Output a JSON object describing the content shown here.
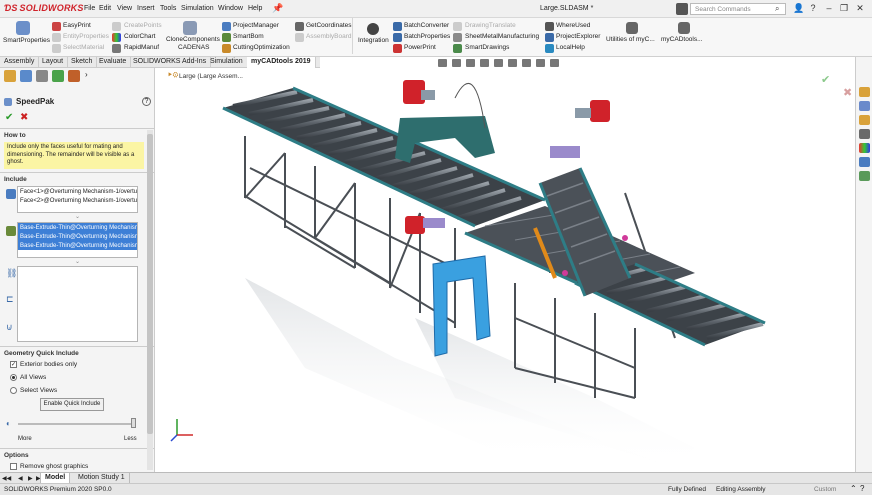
{
  "app": {
    "brand": "SOLIDWORKS",
    "doc_title": "Large.SLDASM *",
    "search_placeholder": "Search Commands"
  },
  "menu": [
    "File",
    "Edit",
    "View",
    "Insert",
    "Tools",
    "Simulation",
    "Window",
    "Help"
  ],
  "ribbon": {
    "smart_properties": "SmartProperties",
    "easyprint": "EasyPrint",
    "entity_properties": "EntityProperties",
    "select_material": "SelectMaterial",
    "create_points": "CreatePoints",
    "color_chart": "ColorChart",
    "rapid_manuf": "RapidManuf",
    "clone_components": "CloneComponents",
    "cadenas": "CADENAS",
    "project_manager": "ProjectManager",
    "smart_bom": "SmartBom",
    "cutting_optimization": "CuttingOptimization",
    "get_coordinates": "GetCoordinates",
    "assembly_board": "AssemblyBoard",
    "integration": "Integration",
    "batch_converter": "BatchConverter",
    "batch_properties": "BatchProperties",
    "power_print": "PowerPrint",
    "drawing_translate": "DrawingTranslate",
    "sheet_metal": "SheetMetalManufacturing",
    "smart_drawings": "SmartDrawings",
    "where_used": "WhereUsed",
    "project_explorer": "ProjectExplorer",
    "local_help": "LocalHelp",
    "utilities": "Utilities of myC...",
    "mycadtools": "myCADtools..."
  },
  "tabs": [
    "Assembly",
    "Layout",
    "Sketch",
    "Evaluate",
    "SOLIDWORKS Add-Ins",
    "Simulation",
    "myCADtools 2019"
  ],
  "active_tab": "myCADtools 2019",
  "panel": {
    "title": "SpeedPak",
    "how_to_title": "How to",
    "how_to_text": "Include only the faces useful for mating and dimensioning.  The remainder will be visible as a ghost.",
    "include_title": "Include",
    "faces": [
      "Face<1>@Overturning Mechanism-1/overtu",
      "Face<2>@Overturning Mechanism-1/overtu"
    ],
    "bodies": [
      "Base-Extrude-Thin@Overturning Mechanism",
      "Base-Extrude-Thin@Overturning Mechanism",
      "Base-Extrude-Thin@Overturning Mechanism"
    ],
    "gqi_title": "Geometry Quick Include",
    "exterior_bodies": "Exterior bodies only",
    "all_views": "All Views",
    "select_views": "Select Views",
    "enable_btn": "Enable Quick Include",
    "more": "More",
    "less": "Less",
    "options_title": "Options",
    "remove_ghost": "Remove ghost graphics"
  },
  "tree_label": "Large  (Large Assem...",
  "bottom_tabs": [
    "Model",
    "Motion Study 1"
  ],
  "status": {
    "product": "SOLIDWORKS Premium 2020 SP0.0",
    "defined": "Fully Defined",
    "mode": "Editing Assembly",
    "units": "Custom"
  },
  "colors": {
    "accent_red": "#d0222a",
    "selection_blue": "#3d7fd6",
    "yellow_box": "#fbf5a4",
    "conveyor_teal": "#2e7d86"
  }
}
